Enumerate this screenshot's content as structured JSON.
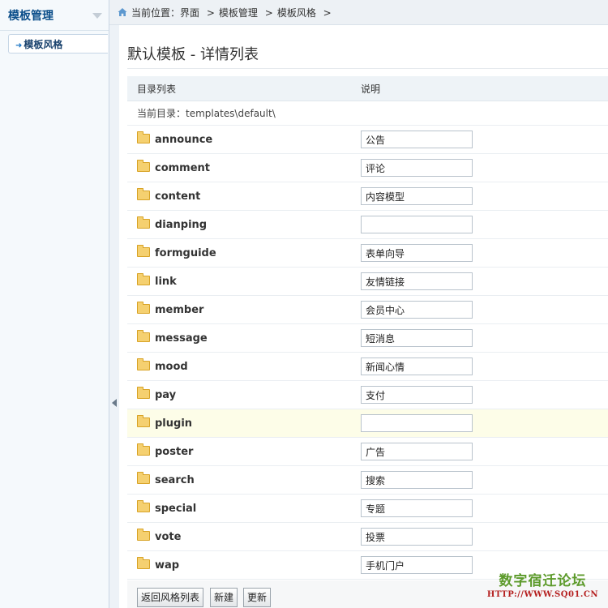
{
  "sidebar": {
    "title": "模板管理",
    "items": [
      {
        "label": "模板风格",
        "active": true
      }
    ]
  },
  "breadcrumb": {
    "prefix": "当前位置：",
    "items": [
      "界面",
      "模板管理",
      "模板风格"
    ],
    "separator": ">"
  },
  "page": {
    "title": "默认模板 - 详情列表"
  },
  "table": {
    "headers": [
      "目录列表",
      "说明"
    ],
    "current_dir_label": "当前目录：templates\\default\\",
    "rows": [
      {
        "name": "announce",
        "desc": "公告"
      },
      {
        "name": "comment",
        "desc": "评论"
      },
      {
        "name": "content",
        "desc": "内容模型"
      },
      {
        "name": "dianping",
        "desc": ""
      },
      {
        "name": "formguide",
        "desc": "表单向导"
      },
      {
        "name": "link",
        "desc": "友情链接"
      },
      {
        "name": "member",
        "desc": "会员中心"
      },
      {
        "name": "message",
        "desc": "短消息"
      },
      {
        "name": "mood",
        "desc": "新闻心情"
      },
      {
        "name": "pay",
        "desc": "支付"
      },
      {
        "name": "plugin",
        "desc": "",
        "highlighted": true
      },
      {
        "name": "poster",
        "desc": "广告"
      },
      {
        "name": "search",
        "desc": "搜索"
      },
      {
        "name": "special",
        "desc": "专题"
      },
      {
        "name": "vote",
        "desc": "投票"
      },
      {
        "name": "wap",
        "desc": "手机门户"
      }
    ]
  },
  "buttons": {
    "back": "返回风格列表",
    "new": "新建",
    "update": "更新"
  },
  "watermark": {
    "line1": "数字宿迁论坛",
    "line2": "HTTP://WWW.SQ01.CN"
  },
  "colors": {
    "sidebar_title": "#0b4e8a",
    "highlight_row": "#fdfde8",
    "folder": "#f5d070",
    "watermark_green": "#5c9a2a",
    "watermark_red": "#b52020"
  },
  "icons": {
    "home": "home-icon",
    "folder": "folder-icon",
    "collapse": "collapse-left-icon",
    "sidebar_arrow": "arrow-right-icon",
    "sidebar_toggle": "triangle-down-icon"
  }
}
